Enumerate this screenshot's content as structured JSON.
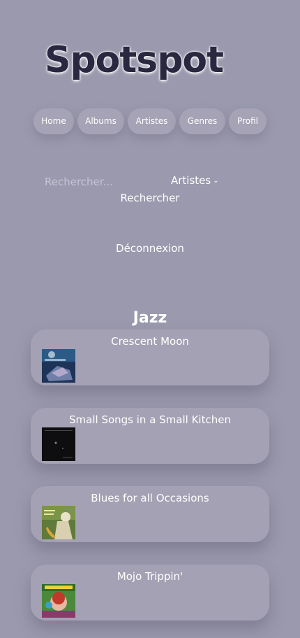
{
  "app": {
    "logo_text": "Spotspot"
  },
  "nav": {
    "items": [
      {
        "label": "Home"
      },
      {
        "label": "Albums"
      },
      {
        "label": "Artistes"
      },
      {
        "label": "Genres"
      },
      {
        "label": "Profil"
      }
    ]
  },
  "search": {
    "placeholder": "Rechercher...",
    "value": "",
    "category_selected": "Artistes",
    "submit_label": "Rechercher"
  },
  "logout_label": "Déconnexion",
  "genre": {
    "title": "Jazz",
    "albums": [
      {
        "title": "Crescent Moon"
      },
      {
        "title": "Small Songs in a Small Kitchen"
      },
      {
        "title": "Blues for all Occasions"
      },
      {
        "title": "Mojo Trippin'"
      }
    ]
  },
  "colors": {
    "background": "#9b99ad",
    "pill": "#a5a3b5",
    "card": "#a3a1b3",
    "logo": "#2a2740",
    "text": "#ffffff"
  }
}
